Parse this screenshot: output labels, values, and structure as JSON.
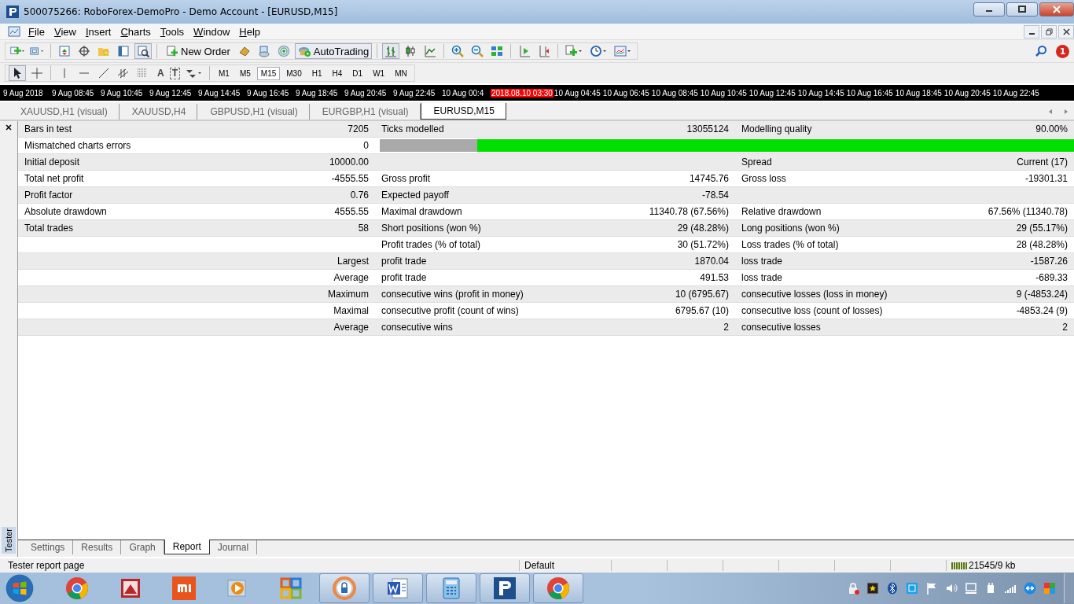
{
  "window": {
    "title": "500075266: RoboForex-DemoPro - Demo Account - [EURUSD,M15]"
  },
  "menu": [
    "File",
    "View",
    "Insert",
    "Charts",
    "Tools",
    "Window",
    "Help"
  ],
  "toolbar": {
    "new_order": "New Order",
    "autotrading": "AutoTrading",
    "notification_count": "1"
  },
  "drawing_tools": {
    "text_tool": "A",
    "label_tool": "T"
  },
  "timeframes": [
    {
      "label": "M1",
      "selected": false
    },
    {
      "label": "M5",
      "selected": false
    },
    {
      "label": "M15",
      "selected": true
    },
    {
      "label": "M30",
      "selected": false
    },
    {
      "label": "H1",
      "selected": false
    },
    {
      "label": "H4",
      "selected": false
    },
    {
      "label": "D1",
      "selected": false
    },
    {
      "label": "W1",
      "selected": false
    },
    {
      "label": "MN",
      "selected": false
    }
  ],
  "timeline": [
    {
      "text": "9 Aug 2018",
      "kind": "tick"
    },
    {
      "text": "9 Aug 08:45",
      "kind": "tick"
    },
    {
      "text": "9 Aug 10:45",
      "kind": "tick"
    },
    {
      "text": "9 Aug 12:45",
      "kind": "tick"
    },
    {
      "text": "9 Aug 14:45",
      "kind": "tick"
    },
    {
      "text": "9 Aug 16:45",
      "kind": "tick"
    },
    {
      "text": "9 Aug 18:45",
      "kind": "tick"
    },
    {
      "text": "9 Aug 20:45",
      "kind": "tick"
    },
    {
      "text": "9 Aug 22:45",
      "kind": "tick"
    },
    {
      "text": "10 Aug 00:4",
      "kind": "tick"
    },
    {
      "text": "2018.08.10 03:30",
      "kind": "cursor"
    },
    {
      "text": "10 Aug 04:45",
      "kind": "tick"
    },
    {
      "text": "10 Aug 06:45",
      "kind": "tick"
    },
    {
      "text": "10 Aug 08:45",
      "kind": "tick"
    },
    {
      "text": "10 Aug 10:45",
      "kind": "tick"
    },
    {
      "text": "10 Aug 12:45",
      "kind": "tick"
    },
    {
      "text": "10 Aug 14:45",
      "kind": "tick"
    },
    {
      "text": "10 Aug 16:45",
      "kind": "tick"
    },
    {
      "text": "10 Aug 18:45",
      "kind": "tick"
    },
    {
      "text": "10 Aug 20:45",
      "kind": "tick"
    },
    {
      "text": "10 Aug 22:45",
      "kind": "tick"
    }
  ],
  "chart_tabs": [
    {
      "label": "XAUUSD,H1 (visual)",
      "selected": false
    },
    {
      "label": "XAUUSD,H4",
      "selected": false
    },
    {
      "label": "GBPUSD,H1 (visual)",
      "selected": false
    },
    {
      "label": "EURGBP,H1 (visual)",
      "selected": false
    },
    {
      "label": "EURUSD,M15",
      "selected": true
    }
  ],
  "tester_label": "Tester",
  "report": {
    "rows": [
      {
        "label1": "Bars in test",
        "value1": "7205",
        "label2": "Ticks modelled",
        "value2": "13055124",
        "label3": "Modelling quality",
        "value3": "90.00%"
      },
      {
        "label1": "Mismatched charts errors",
        "value1": "0",
        "level": 0.86
      },
      {
        "label1": "Initial deposit",
        "value1": "10000.00",
        "label3": "Spread",
        "value3": "Current (17)"
      },
      {
        "label1": "Total net profit",
        "value1": "-4555.55",
        "label2": "Gross profit",
        "value2": "14745.76",
        "label3": "Gross loss",
        "value3": "-19301.31"
      },
      {
        "label1": "Profit factor",
        "value1": "0.76",
        "label2": "Expected payoff",
        "value2": "-78.54"
      },
      {
        "label1": "Absolute drawdown",
        "value1": "4555.55",
        "label2": "Maximal drawdown",
        "value2": "11340.78 (67.56%)",
        "label3": "Relative drawdown",
        "value3": "67.56% (11340.78)"
      },
      {
        "label1": "Total trades",
        "value1": "58",
        "label2": "Short positions (won %)",
        "value2": "29 (48.28%)",
        "label3": "Long positions (won %)",
        "value3": "29 (55.17%)"
      },
      {
        "label2": "Profit trades (% of total)",
        "value2": "30 (51.72%)",
        "label3": "Loss trades (% of total)",
        "value3": "28 (48.28%)"
      },
      {
        "value1": "Largest",
        "label2": "profit trade",
        "value2": "1870.04",
        "label3": "loss trade",
        "value3": "-1587.26"
      },
      {
        "value1": "Average",
        "label2": "profit trade",
        "value2": "491.53",
        "label3": "loss trade",
        "value3": "-689.33"
      },
      {
        "value1": "Maximum",
        "label2": "consecutive wins (profit in money)",
        "value2": "10 (6795.67)",
        "label3": "consecutive losses (loss in money)",
        "value3": "9 (-4853.24)"
      },
      {
        "value1": "Maximal",
        "label2": "consecutive profit (count of wins)",
        "value2": "6795.67 (10)",
        "label3": "consecutive loss (count of losses)",
        "value3": "-4853.24 (9)"
      },
      {
        "value1": "Average",
        "label2": "consecutive wins",
        "value2": "2",
        "label3": "consecutive losses",
        "value3": "2"
      }
    ]
  },
  "bottom_tabs": [
    {
      "label": "Settings",
      "selected": false
    },
    {
      "label": "Results",
      "selected": false
    },
    {
      "label": "Graph",
      "selected": false
    },
    {
      "label": "Report",
      "selected": true
    },
    {
      "label": "Journal",
      "selected": false
    }
  ],
  "status_bar": [
    "Tester report page",
    "Default",
    "21545/9 kb"
  ]
}
